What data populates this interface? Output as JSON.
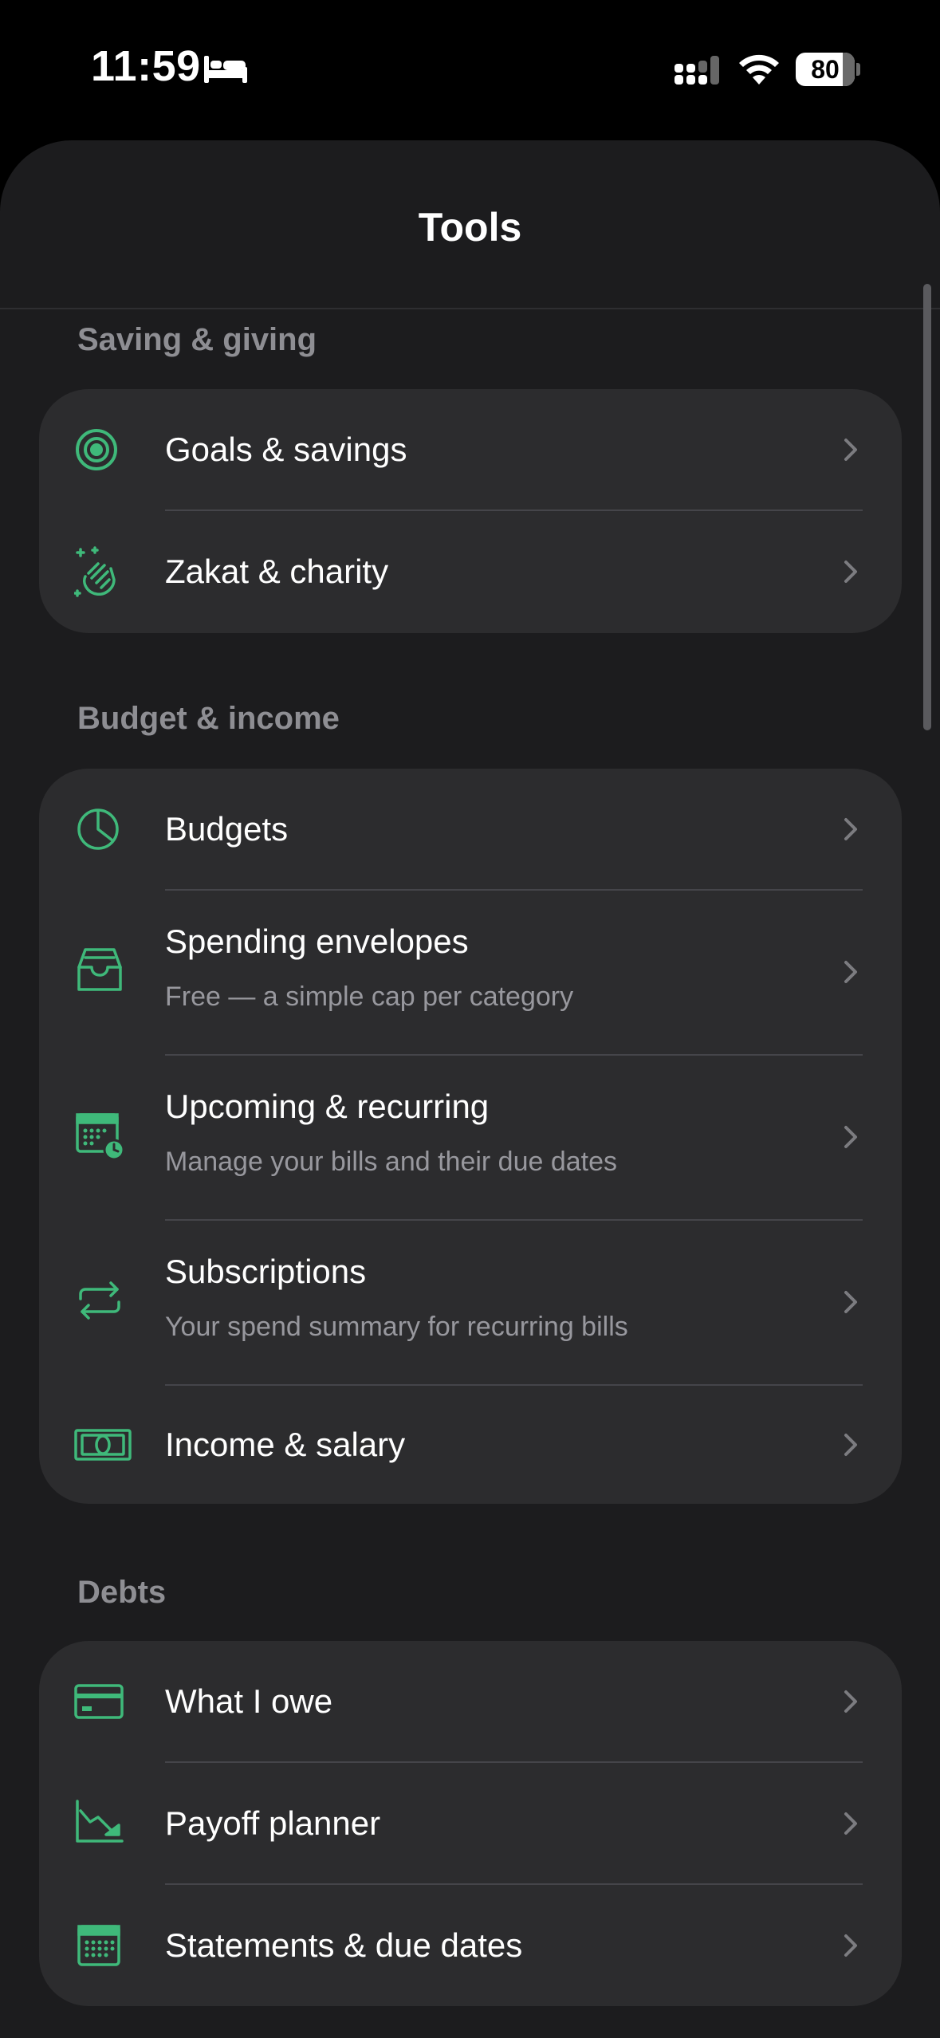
{
  "status_bar": {
    "time": "11:59",
    "battery_level": "80",
    "battery_fraction": 0.8
  },
  "header": {
    "title": "Tools"
  },
  "colors": {
    "accent": "#3fb97a",
    "background": "#1c1c1e",
    "card": "#2c2c2e",
    "secondary_text": "#8e8e93"
  },
  "sections": [
    {
      "title": "Saving & giving",
      "items": [
        {
          "title": "Goals & savings",
          "subtitle": "",
          "icon": "target-icon"
        },
        {
          "title": "Zakat & charity",
          "subtitle": "",
          "icon": "clapping-hands-icon"
        }
      ]
    },
    {
      "title": "Budget & income",
      "items": [
        {
          "title": "Budgets",
          "subtitle": "",
          "icon": "pie-chart-icon"
        },
        {
          "title": "Spending envelopes",
          "subtitle": "Free — a simple cap per category",
          "icon": "inbox-icon"
        },
        {
          "title": "Upcoming & recurring",
          "subtitle": "Manage your bills and their due dates",
          "icon": "calendar-clock-icon"
        },
        {
          "title": "Subscriptions",
          "subtitle": "Your spend summary for recurring bills",
          "icon": "repeat-icon"
        },
        {
          "title": "Income & salary",
          "subtitle": "",
          "icon": "banknote-icon"
        }
      ]
    },
    {
      "title": "Debts",
      "items": [
        {
          "title": "What I owe",
          "subtitle": "",
          "icon": "credit-card-icon"
        },
        {
          "title": "Payoff planner",
          "subtitle": "",
          "icon": "chart-down-icon"
        },
        {
          "title": "Statements & due dates",
          "subtitle": "",
          "icon": "calendar-icon"
        }
      ]
    }
  ]
}
